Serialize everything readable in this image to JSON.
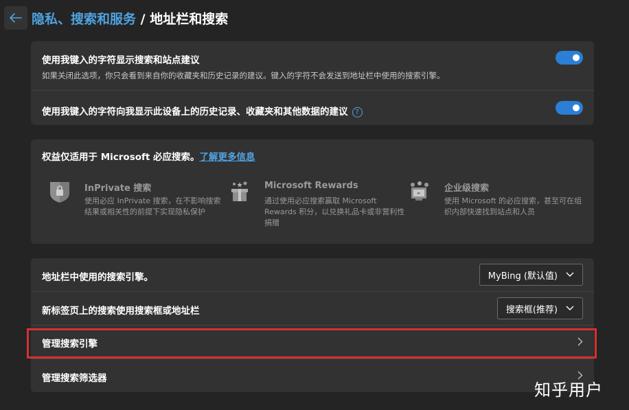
{
  "header": {
    "breadcrumb_parent": "隐私、搜索和服务",
    "breadcrumb_sep": " / ",
    "breadcrumb_current": "地址栏和搜索"
  },
  "suggestions": {
    "row1_title": "使用我键入的字符显示搜索和站点建议",
    "row1_desc": "如果关闭此选项，你只会看到来自你的收藏夹和历史记录的建议。键入的字符不会发送到地址栏中使用的搜索引擎。",
    "row1_toggle": "on",
    "row2_title": "使用我键入的字符向我显示此设备上的历史记录、收藏夹和其他数据的建议",
    "row2_toggle": "on",
    "help_glyph": "?"
  },
  "benefits": {
    "intro": "权益仅适用于 Microsoft 必应搜索。",
    "learn_more": "了解更多信息",
    "features": [
      {
        "icon": "inprivate-shield-icon",
        "title": "InPrivate 搜索",
        "desc": "使用必应 InPrivate 搜索，在不影响搜索结果或相关性的前提下实现隐私保护"
      },
      {
        "icon": "rewards-gift-icon",
        "title": "Microsoft Rewards",
        "desc": "通过使用必应搜索赢取 Microsoft Rewards 积分，以兑换礼品卡或非营利性捐赠"
      },
      {
        "icon": "enterprise-search-icon",
        "title": "企业级搜索",
        "desc": "使用 Microsoft 的必应搜索，甚至可在组织内部快速找到站点和人员"
      }
    ]
  },
  "search_settings": {
    "engine_label": "地址栏中使用的搜索引擎。",
    "engine_value": "MyBing (默认值)",
    "newtab_label": "新标签页上的搜索使用搜索框或地址栏",
    "newtab_value": "搜索框(推荐)",
    "manage_engines": "管理搜索引擎",
    "manage_filters": "管理搜索筛选器"
  },
  "watermark": "知乎用户",
  "colors": {
    "accent": "#2b7fd6",
    "link": "#4fa3e0",
    "highlight": "#d6312f",
    "background": "#242424",
    "card": "#323232"
  }
}
